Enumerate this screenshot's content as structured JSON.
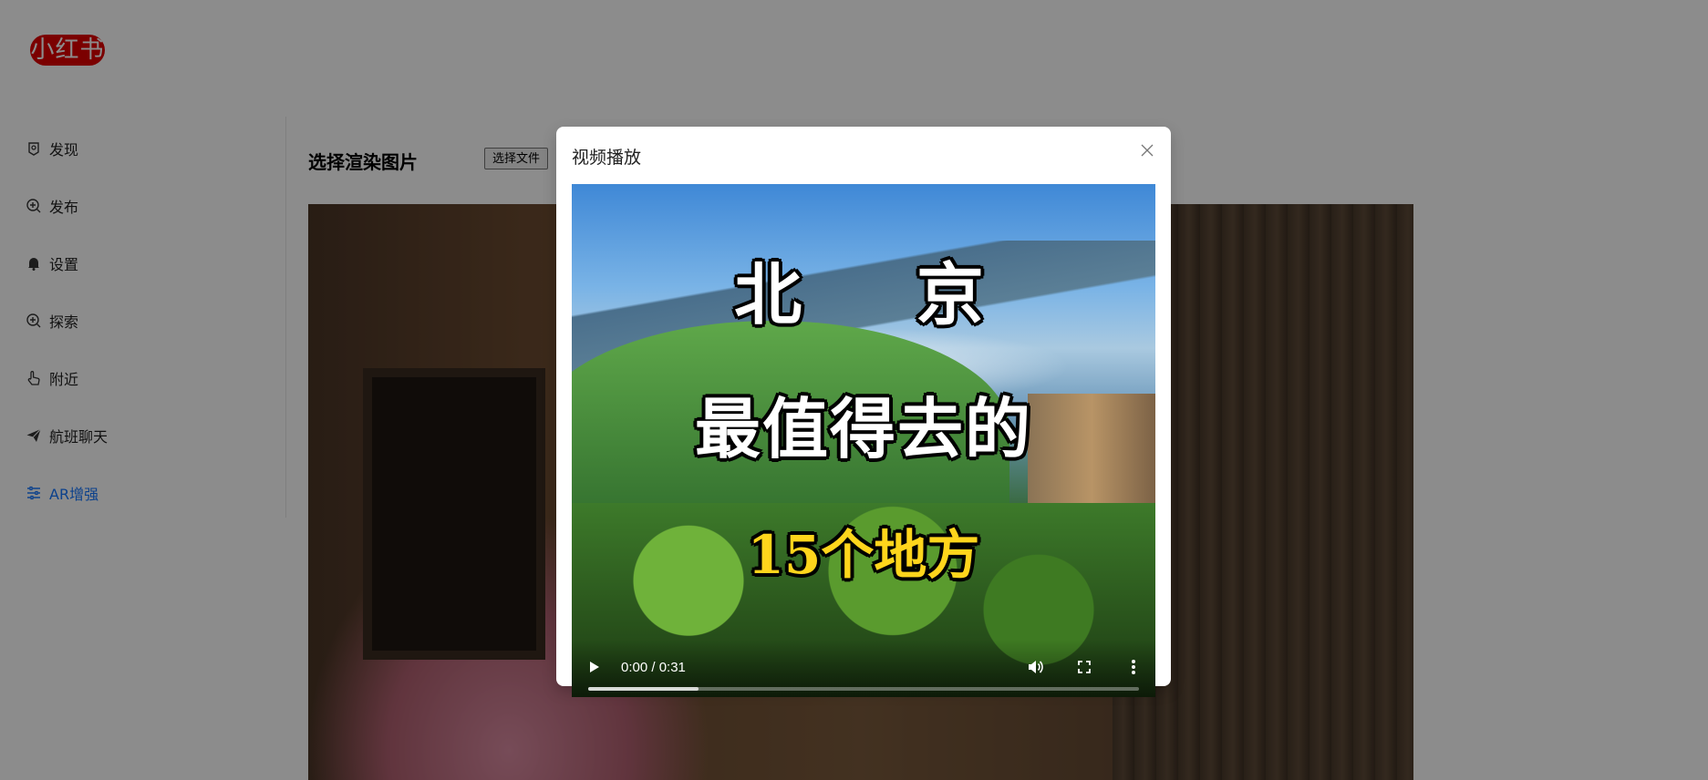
{
  "app": {
    "logo_text": "小红书"
  },
  "sidebar": {
    "items": [
      {
        "label": "发现",
        "icon": "discover-icon"
      },
      {
        "label": "发布",
        "icon": "publish-icon"
      },
      {
        "label": "设置",
        "icon": "bell-icon"
      },
      {
        "label": "探索",
        "icon": "explore-icon"
      },
      {
        "label": "附近",
        "icon": "hand-icon"
      },
      {
        "label": "航班聊天",
        "icon": "send-icon"
      },
      {
        "label": "AR增强",
        "icon": "sliders-icon",
        "active": true
      }
    ]
  },
  "main": {
    "title": "选择渲染图片",
    "file_button_label": "选择文件"
  },
  "modal": {
    "title": "视频播放",
    "video": {
      "title_line1": "北 京",
      "title_line2": "最值得去的",
      "title_line3": "15个地方",
      "time_display": "0:00 / 0:31",
      "buffered_fraction": 0.2
    }
  },
  "colors": {
    "brand": "#e00000",
    "active": "#1677ff",
    "overlay": "rgba(0,0,0,0.45)",
    "video_title_accent": "#ffd51c"
  }
}
